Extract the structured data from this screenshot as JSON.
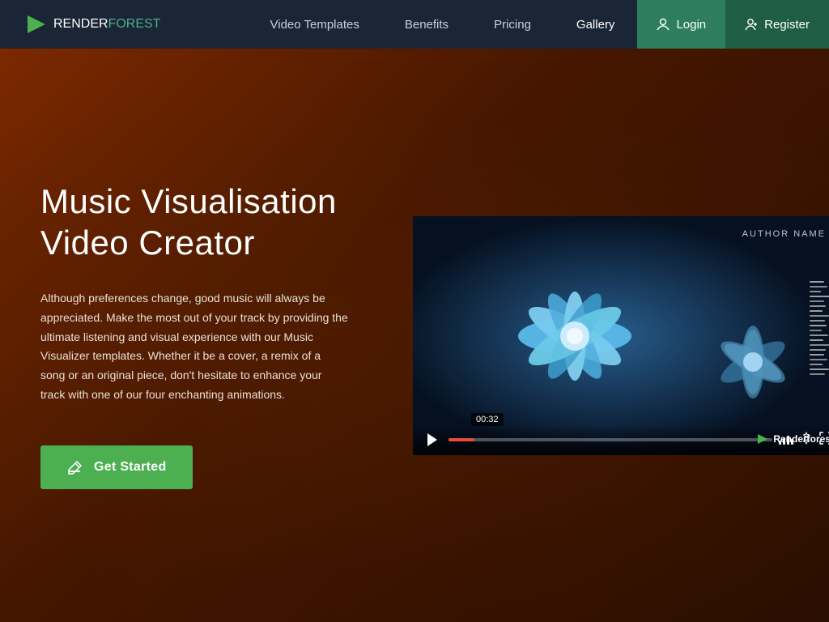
{
  "brand": {
    "render": "RENDER",
    "forest": "FOREST"
  },
  "navbar": {
    "links": [
      {
        "id": "video-templates",
        "label": "Video Templates",
        "active": false
      },
      {
        "id": "benefits",
        "label": "Benefits",
        "active": false
      },
      {
        "id": "pricing",
        "label": "Pricing",
        "active": false
      },
      {
        "id": "gallery",
        "label": "Gallery",
        "active": true
      }
    ],
    "login_label": "Login",
    "register_label": "Register"
  },
  "hero": {
    "title": "Music Visualisation Video Creator",
    "description": "Although preferences change, good music will always be appreciated. Make the most out of your track by providing the ultimate listening and visual experience with our Music Visualizer templates. Whether it be a cover, a remix of a song or an original piece, don't hesitate to enhance your track with one of our four enchanting animations.",
    "cta_label": "Get Started"
  },
  "video": {
    "author_name": "AUTHOR NAME",
    "timestamp": "00:32",
    "watermark": "Renderforest",
    "progress_percent": 8
  },
  "colors": {
    "accent_green": "#4caf50",
    "nav_bg": "#1a2535",
    "login_bg": "#2e7d5e",
    "register_bg": "#1f5e45"
  }
}
